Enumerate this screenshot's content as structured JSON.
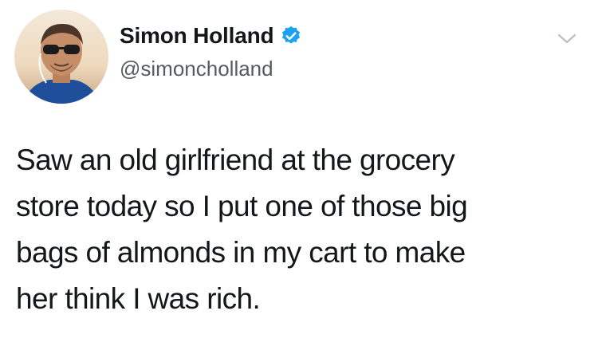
{
  "tweet": {
    "author": {
      "display_name": "Simon Holland",
      "handle": "@simoncholland",
      "verified": true,
      "avatar_icon": "profile-photo"
    },
    "menu_icon": "chevron-down-icon",
    "text_lines": [
      "Saw an old girlfriend at the grocery",
      "store today so I put one of those big",
      "bags of almonds in my cart to make",
      "her think I was rich."
    ]
  },
  "colors": {
    "verified_badge": "#1da1f2",
    "text": "#14171a",
    "handle": "#555b60",
    "chevron": "#b8bfc5"
  }
}
